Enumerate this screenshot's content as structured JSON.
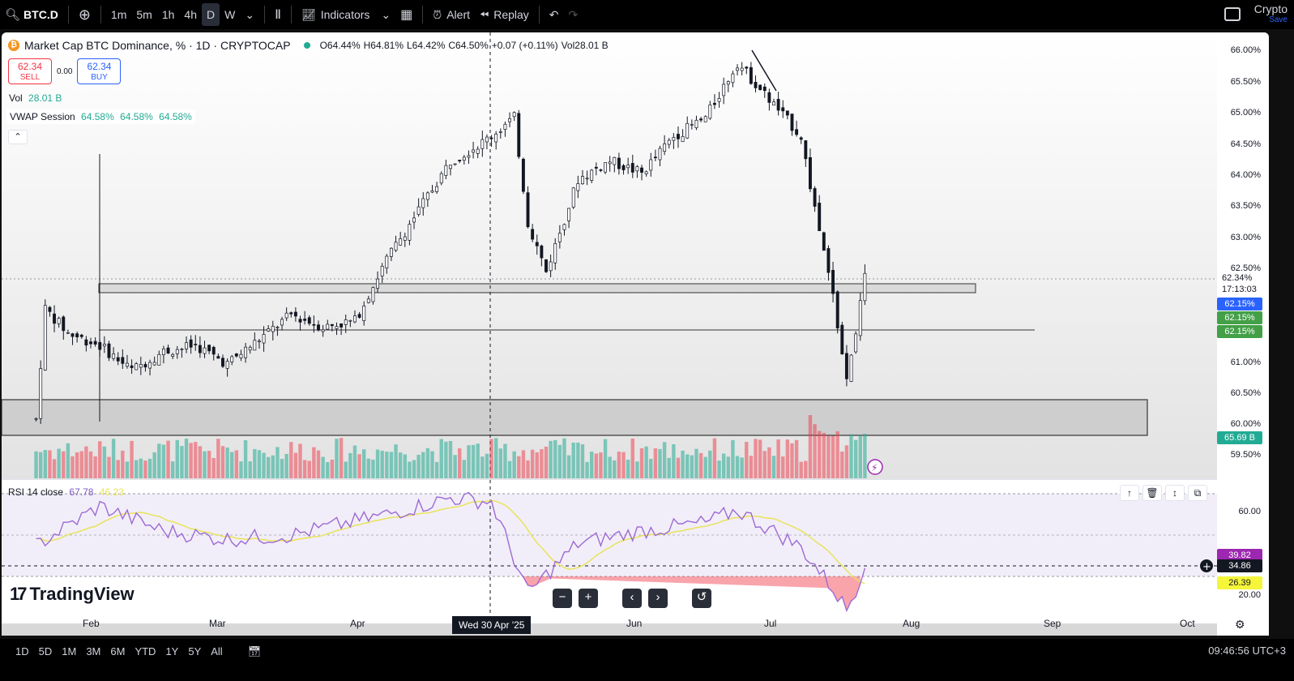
{
  "topbar": {
    "symbol": "BTC.D",
    "timeframes": [
      "1m",
      "5m",
      "1h",
      "4h",
      "D",
      "W"
    ],
    "active_timeframe": "D",
    "indicators_label": "Indicators",
    "alert_label": "Alert",
    "replay_label": "Replay",
    "account_label": "Crypto",
    "account_sub": "Save"
  },
  "legend": {
    "title": "Market Cap BTC Dominance, % · 1D · CRYPTOCAP",
    "open": "O64.44%",
    "high": "H64.81%",
    "low": "L64.42%",
    "close": "C64.50%",
    "change": "+0.07 (+0.11%)",
    "vol": "Vol28.01 B",
    "sell_price": "62.34",
    "sell_label": "SELL",
    "spread": "0.00",
    "buy_price": "62.34",
    "buy_label": "BUY",
    "vol_label": "Vol",
    "vol_value": "28.01 B",
    "vwap_label": "VWAP Session",
    "vwap_values": [
      "64.58%",
      "64.58%",
      "64.58%"
    ]
  },
  "price_scale": {
    "ticks": [
      "66.00%",
      "65.50%",
      "65.00%",
      "64.50%",
      "64.00%",
      "63.50%",
      "63.00%",
      "62.50%",
      "61.00%",
      "60.50%",
      "60.00%",
      "59.50%"
    ],
    "last_price": "62.34%",
    "countdown": "17:13:03",
    "vwap_badges": [
      "62.15%",
      "62.15%",
      "62.15%"
    ],
    "volume_badge": "65.69 B"
  },
  "rsi": {
    "label": "RSI 14 close",
    "value": "67.78",
    "ma_value": "46.23",
    "ticks": [
      "60.00",
      "20.00"
    ],
    "badges": [
      "39.82",
      "34.86",
      "26.39"
    ]
  },
  "time_axis": {
    "labels": [
      "Feb",
      "Mar",
      "Apr",
      "Jun",
      "Jul",
      "Aug",
      "Sep",
      "Oct"
    ],
    "crosshair_label": "Wed 30 Apr '25"
  },
  "bottombar": {
    "ranges": [
      "1D",
      "5D",
      "1M",
      "3M",
      "6M",
      "YTD",
      "1Y",
      "5Y",
      "All"
    ],
    "clock": "09:46:56 UTC+3"
  },
  "branding": "TradingView",
  "colors": {
    "up": "#22ab94",
    "down": "#f23645",
    "rsi": "#9c6ad4",
    "rsi_ma": "#e8e35a",
    "accent": "#2962ff"
  },
  "chart_data": {
    "type": "candlestick",
    "symbol": "BTC.D",
    "interval": "1D",
    "ylim": [
      59.3,
      66.3
    ],
    "close_path": [
      [
        "Jan 20",
        60.0
      ],
      [
        "Jan 22",
        61.8
      ],
      [
        "Jan 27",
        61.4
      ],
      [
        "Feb 3",
        61.2
      ],
      [
        "Feb 10",
        60.8
      ],
      [
        "Feb 17",
        61.1
      ],
      [
        "Feb 24",
        61.2
      ],
      [
        "Mar 3",
        60.9
      ],
      [
        "Mar 10",
        61.3
      ],
      [
        "Mar 17",
        61.7
      ],
      [
        "Mar 24",
        61.5
      ],
      [
        "Mar 31",
        61.6
      ],
      [
        "Apr 7",
        62.6
      ],
      [
        "Apr 14",
        63.4
      ],
      [
        "Apr 21",
        64.2
      ],
      [
        "Apr 28",
        64.5
      ],
      [
        "May 5",
        64.9
      ],
      [
        "May 8",
        63.2
      ],
      [
        "May 12",
        62.4
      ],
      [
        "May 19",
        63.9
      ],
      [
        "May 26",
        64.2
      ],
      [
        "Jun 2",
        64.0
      ],
      [
        "Jun 9",
        64.6
      ],
      [
        "Jun 16",
        64.9
      ],
      [
        "Jun 23",
        65.8
      ],
      [
        "Jun 30",
        65.2
      ],
      [
        "Jul 7",
        64.6
      ],
      [
        "Jul 10",
        63.4
      ],
      [
        "Jul 14",
        62.0
      ],
      [
        "Jul 17",
        60.6
      ],
      [
        "Jul 21",
        62.3
      ]
    ],
    "rsi_path": [
      [
        "Jan 20",
        45
      ],
      [
        "Feb 3",
        64
      ],
      [
        "Feb 17",
        52
      ],
      [
        "Mar 3",
        48
      ],
      [
        "Mar 17",
        50
      ],
      [
        "Apr 7",
        60
      ],
      [
        "Apr 21",
        68
      ],
      [
        "Apr 30",
        66
      ],
      [
        "May 8",
        22
      ],
      [
        "May 19",
        46
      ],
      [
        "Jun 2",
        52
      ],
      [
        "Jun 16",
        56
      ],
      [
        "Jun 23",
        62
      ],
      [
        "Jul 7",
        44
      ],
      [
        "Jul 14",
        24
      ],
      [
        "Jul 17",
        14
      ],
      [
        "Jul 21",
        34
      ]
    ]
  }
}
